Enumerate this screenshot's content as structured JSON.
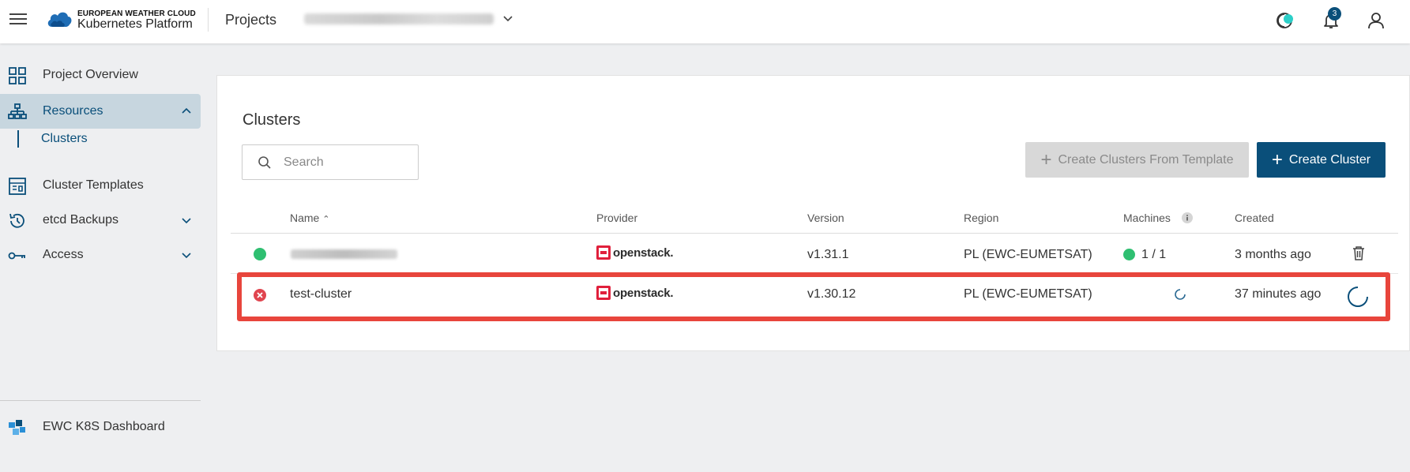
{
  "header": {
    "brand_top": "EUROPEAN WEATHER CLOUD",
    "brand_bottom": "Kubernetes Platform",
    "projects_label": "Projects",
    "notification_count": "3"
  },
  "sidebar": {
    "items": [
      {
        "label": "Project Overview",
        "icon": "grid-icon"
      },
      {
        "label": "Resources",
        "icon": "sitemap-icon"
      },
      {
        "label": "Clusters"
      },
      {
        "label": "Cluster Templates",
        "icon": "template-icon"
      },
      {
        "label": "etcd Backups",
        "icon": "history-icon"
      },
      {
        "label": "Access",
        "icon": "key-icon"
      }
    ],
    "footer_label": "EWC K8S Dashboard"
  },
  "main": {
    "title": "Clusters",
    "search_placeholder": "Search",
    "create_from_template_label": "Create Clusters From Template",
    "create_cluster_label": "Create Cluster",
    "columns": [
      "Name",
      "Provider",
      "Version",
      "Region",
      "Machines",
      "Created"
    ],
    "rows": [
      {
        "status": "running",
        "name": "",
        "provider": "openstack.",
        "version": "v1.31.1",
        "region": "PL (EWC-EUMETSAT)",
        "machines": "1 / 1",
        "created": "3 months ago"
      },
      {
        "status": "error",
        "name": "test-cluster",
        "provider": "openstack.",
        "version": "v1.30.12",
        "region": "PL (EWC-EUMETSAT)",
        "machines": "",
        "created": "37 minutes ago"
      }
    ]
  },
  "colors": {
    "accent": "#0a4f7a",
    "active_bg": "#c7d6df",
    "status_green": "#2fbf71",
    "status_red": "#e0454f",
    "highlight_red": "#e8453c",
    "openstack_red": "#e0203c"
  }
}
